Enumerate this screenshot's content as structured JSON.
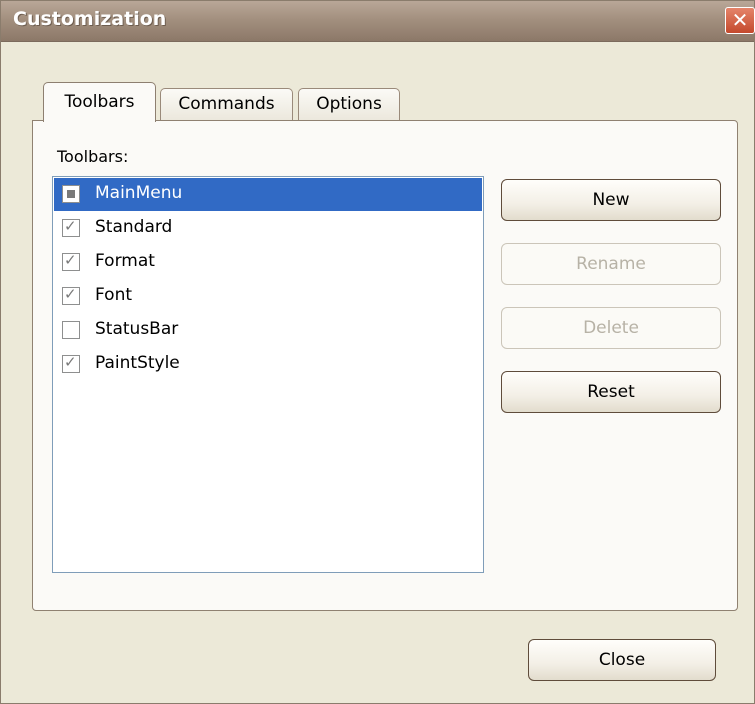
{
  "window": {
    "title": "Customization",
    "close_glyph": "✕"
  },
  "tabs": [
    {
      "label": "Toolbars",
      "active": true
    },
    {
      "label": "Commands",
      "active": false
    },
    {
      "label": "Options",
      "active": false
    }
  ],
  "panel": {
    "list_label": "Toolbars:",
    "items": [
      {
        "label": "MainMenu",
        "state": "indeterminate",
        "selected": true
      },
      {
        "label": "Standard",
        "state": "checked",
        "selected": false
      },
      {
        "label": "Format",
        "state": "checked",
        "selected": false
      },
      {
        "label": "Font",
        "state": "checked",
        "selected": false
      },
      {
        "label": "StatusBar",
        "state": "unchecked",
        "selected": false
      },
      {
        "label": "PaintStyle",
        "state": "checked",
        "selected": false
      }
    ],
    "buttons": {
      "new": "New",
      "rename": "Rename",
      "delete": "Delete",
      "reset": "Reset"
    }
  },
  "footer": {
    "close_label": "Close"
  },
  "icons": {
    "check": "check-icon",
    "indeterminate": "square-icon",
    "close": "close-icon"
  }
}
